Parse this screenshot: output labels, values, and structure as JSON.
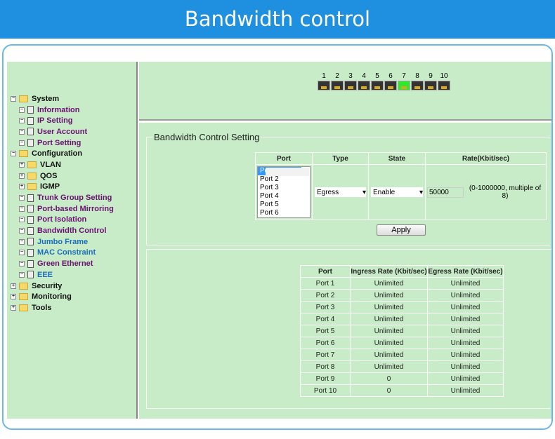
{
  "banner": {
    "title": "Bandwidth control"
  },
  "sidebar": {
    "items": [
      {
        "label": "System",
        "level": 0,
        "icon": "folder-open-icon",
        "toggle": "minus",
        "color": "black"
      },
      {
        "label": "Information",
        "level": 1,
        "icon": "document-icon",
        "toggle": "minus",
        "color": "purple"
      },
      {
        "label": "IP Setting",
        "level": 1,
        "icon": "document-icon",
        "toggle": "minus",
        "color": "purple"
      },
      {
        "label": "User Account",
        "level": 1,
        "icon": "document-icon",
        "toggle": "minus",
        "color": "purple"
      },
      {
        "label": "Port Setting",
        "level": 1,
        "icon": "document-icon",
        "toggle": "minus",
        "color": "purple"
      },
      {
        "label": "Configuration",
        "level": 0,
        "icon": "folder-open-icon",
        "toggle": "minus",
        "color": "black"
      },
      {
        "label": "VLAN",
        "level": 1,
        "icon": "folder-icon",
        "toggle": "plus",
        "color": "black"
      },
      {
        "label": "QOS",
        "level": 1,
        "icon": "folder-icon",
        "toggle": "plus",
        "color": "black"
      },
      {
        "label": "IGMP",
        "level": 1,
        "icon": "folder-icon",
        "toggle": "plus",
        "color": "black"
      },
      {
        "label": "Trunk Group Setting",
        "level": 1,
        "icon": "document-icon",
        "toggle": "minus",
        "color": "purple"
      },
      {
        "label": "Port-based Mirroring",
        "level": 1,
        "icon": "document-icon",
        "toggle": "minus",
        "color": "purple"
      },
      {
        "label": "Port Isolation",
        "level": 1,
        "icon": "document-icon",
        "toggle": "minus",
        "color": "purple"
      },
      {
        "label": "Bandwidth Control",
        "level": 1,
        "icon": "document-icon",
        "toggle": "minus",
        "color": "purple"
      },
      {
        "label": "Jumbo Frame",
        "level": 1,
        "icon": "document-icon",
        "toggle": "minus",
        "color": "blue"
      },
      {
        "label": "MAC Constraint",
        "level": 1,
        "icon": "document-icon",
        "toggle": "minus",
        "color": "blue"
      },
      {
        "label": "Green Ethernet",
        "level": 1,
        "icon": "document-icon",
        "toggle": "minus",
        "color": "purple"
      },
      {
        "label": "EEE",
        "level": 1,
        "icon": "document-icon",
        "toggle": "minus",
        "color": "blue"
      },
      {
        "label": "Security",
        "level": 0,
        "icon": "folder-icon",
        "toggle": "plus",
        "color": "black"
      },
      {
        "label": "Monitoring",
        "level": 0,
        "icon": "folder-icon",
        "toggle": "plus",
        "color": "black"
      },
      {
        "label": "Tools",
        "level": 0,
        "icon": "folder-icon",
        "toggle": "plus",
        "color": "black"
      }
    ]
  },
  "port_panel": {
    "ports": [
      {
        "label": "1",
        "link": false
      },
      {
        "label": "2",
        "link": false
      },
      {
        "label": "3",
        "link": false
      },
      {
        "label": "4",
        "link": false
      },
      {
        "label": "5",
        "link": false
      },
      {
        "label": "6",
        "link": false
      },
      {
        "label": "7",
        "link": true
      },
      {
        "label": "8",
        "link": false
      },
      {
        "label": "9",
        "link": false
      },
      {
        "label": "10",
        "link": false
      }
    ]
  },
  "setting": {
    "title": "Bandwidth Control Setting",
    "headers": {
      "port": "Port",
      "type": "Type",
      "state": "State",
      "rate": "Rate(Kbit/sec)"
    },
    "port_options": [
      "Port 1",
      "Port 2",
      "Port 3",
      "Port 4",
      "Port 5",
      "Port 6"
    ],
    "selected_port": "Port 1",
    "type_value": "Egress",
    "state_value": "Enable",
    "rate_value": "50000",
    "rate_hint": "(0-1000000, multiple of 8)",
    "apply_label": "Apply"
  },
  "status": {
    "headers": [
      "Port",
      "Ingress Rate (Kbit/sec)",
      "Egress Rate (Kbit/sec)"
    ],
    "rows": [
      [
        "Port 1",
        "Unlimited",
        "Unlimited"
      ],
      [
        "Port 2",
        "Unlimited",
        "Unlimited"
      ],
      [
        "Port 3",
        "Unlimited",
        "Unlimited"
      ],
      [
        "Port 4",
        "Unlimited",
        "Unlimited"
      ],
      [
        "Port 5",
        "Unlimited",
        "Unlimited"
      ],
      [
        "Port 6",
        "Unlimited",
        "Unlimited"
      ],
      [
        "Port 7",
        "Unlimited",
        "Unlimited"
      ],
      [
        "Port 8",
        "Unlimited",
        "Unlimited"
      ],
      [
        "Port 9",
        "0",
        "Unlimited"
      ],
      [
        "Port 10",
        "0",
        "Unlimited"
      ]
    ]
  }
}
